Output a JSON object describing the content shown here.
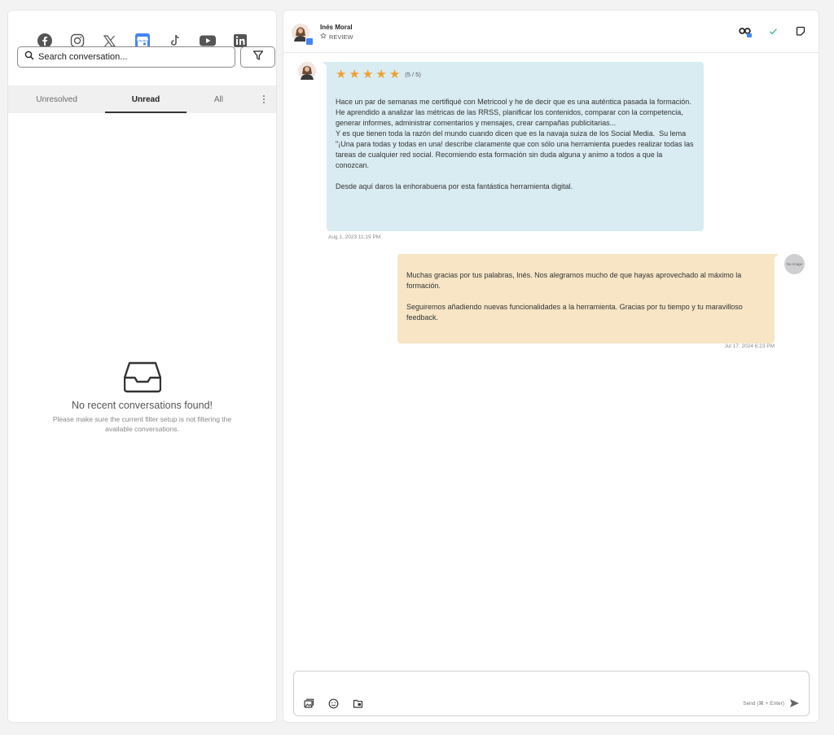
{
  "networks": [
    {
      "name": "facebook-icon"
    },
    {
      "name": "instagram-icon"
    },
    {
      "name": "x-icon"
    },
    {
      "name": "google-business-icon",
      "active": true,
      "color": "#4285f4"
    },
    {
      "name": "tiktok-icon"
    },
    {
      "name": "youtube-icon"
    },
    {
      "name": "linkedin-icon"
    }
  ],
  "search": {
    "placeholder": "Search conversation..."
  },
  "tabs": [
    {
      "label": "Unresolved"
    },
    {
      "label": "Unread",
      "active": true
    },
    {
      "label": "All"
    }
  ],
  "empty_state": {
    "title": "No recent conversations found!",
    "description": "Please make sure the current filter setup is not filtering the available conversations."
  },
  "conversation": {
    "contact_name": "Inés Moral",
    "contact_type": "REVIEW"
  },
  "messages": [
    {
      "direction": "incoming",
      "rating_text": "(5 / 5)",
      "stars": 5,
      "body": "Hace un par de semanas me certifiqué con Metricool y he de decir que es una auténtica pasada la formación. He aprendido a analizar las métricas de las RRSS, planificar los contenidos, comparar con la competencia, generar informes, administrar comentarios y mensajes, crear campañas publicitarias...\nY es que tienen toda la razón del mundo cuando dicen que es la navaja suiza de los Social Media.  Su lema  \"¡Una para todas y todas en una! describe claramente que con sólo una herramienta puedes realizar todas las tareas de cualquier red social. Recomiendo esta formación sin duda alguna y animo a todos a que la conozcan.\n\nDesde aquí daros la enhorabuena por esta fantástica herramienta digital.",
      "timestamp": "Aug 1, 2023 11:19 PM",
      "color": "#d8ecf2"
    },
    {
      "direction": "outgoing",
      "avatar_text": "No image",
      "body": "Muchas gracias por tus palabras, Inés. Nos alegramos mucho de que hayas aprovechado al máximo la formación.\n\nSeguiremos añadiendo nuevas funcionalidades a la herramienta. Gracias por tu tiempo y tu maravilloso feedback.",
      "timestamp": "Jul 17, 2024 6:23 PM",
      "color": "#f7e5c5"
    }
  ],
  "composer": {
    "send_hint": "Send (⌘ + Enter)"
  },
  "colors": {
    "accent": "#4285f4",
    "star": "#f0a030",
    "check": "#3fb27f"
  }
}
